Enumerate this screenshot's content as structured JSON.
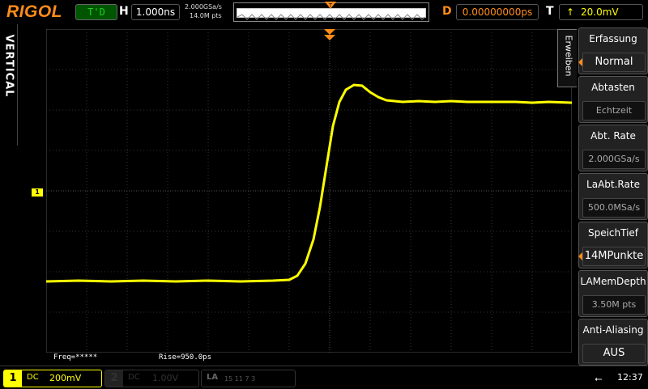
{
  "brand": "RIGOL",
  "run_state": "T'D",
  "horizontal": {
    "label": "H",
    "timebase": "1.000ns"
  },
  "acquisition": {
    "sample_rate": "2.000GSa/s",
    "memory_points": "14.0M pts"
  },
  "delay": {
    "label": "D",
    "value": "0.00000000ps"
  },
  "trigger": {
    "label": "T",
    "icon": "rising-edge-icon",
    "level": "20.0mV"
  },
  "vertical_tab": "VERTICAL",
  "expand_tab": "Erweiben",
  "menu": [
    {
      "title": "Erfassung",
      "value": "Normal"
    },
    {
      "title": "Abtasten",
      "value": "Echtzeit"
    },
    {
      "title": "Abt. Rate",
      "value": "2.000GSa/s"
    },
    {
      "title": "LaAbt.Rate",
      "value": "500.0MSa/s"
    },
    {
      "title": "SpeichTief",
      "value": "14MPunkte"
    },
    {
      "title": "LAMemDepth",
      "value": "3.50M pts"
    },
    {
      "title": "Anti-Aliasing",
      "value": "AUS"
    }
  ],
  "measurements": {
    "freq": "Freq=*****",
    "rise": "Rise=950.0ps"
  },
  "channel1": {
    "number": "1",
    "coupling": "DC",
    "scale": "200mV",
    "marker": "1"
  },
  "channel2": {
    "number": "2",
    "coupling": "DC",
    "scale": "1.00V"
  },
  "la": {
    "label": "LA",
    "digits": "15    11    7    3"
  },
  "clock": "12:37",
  "colors": {
    "accent": "#ff8c1a",
    "ch1": "#ffff00",
    "grid": "#444444"
  }
}
